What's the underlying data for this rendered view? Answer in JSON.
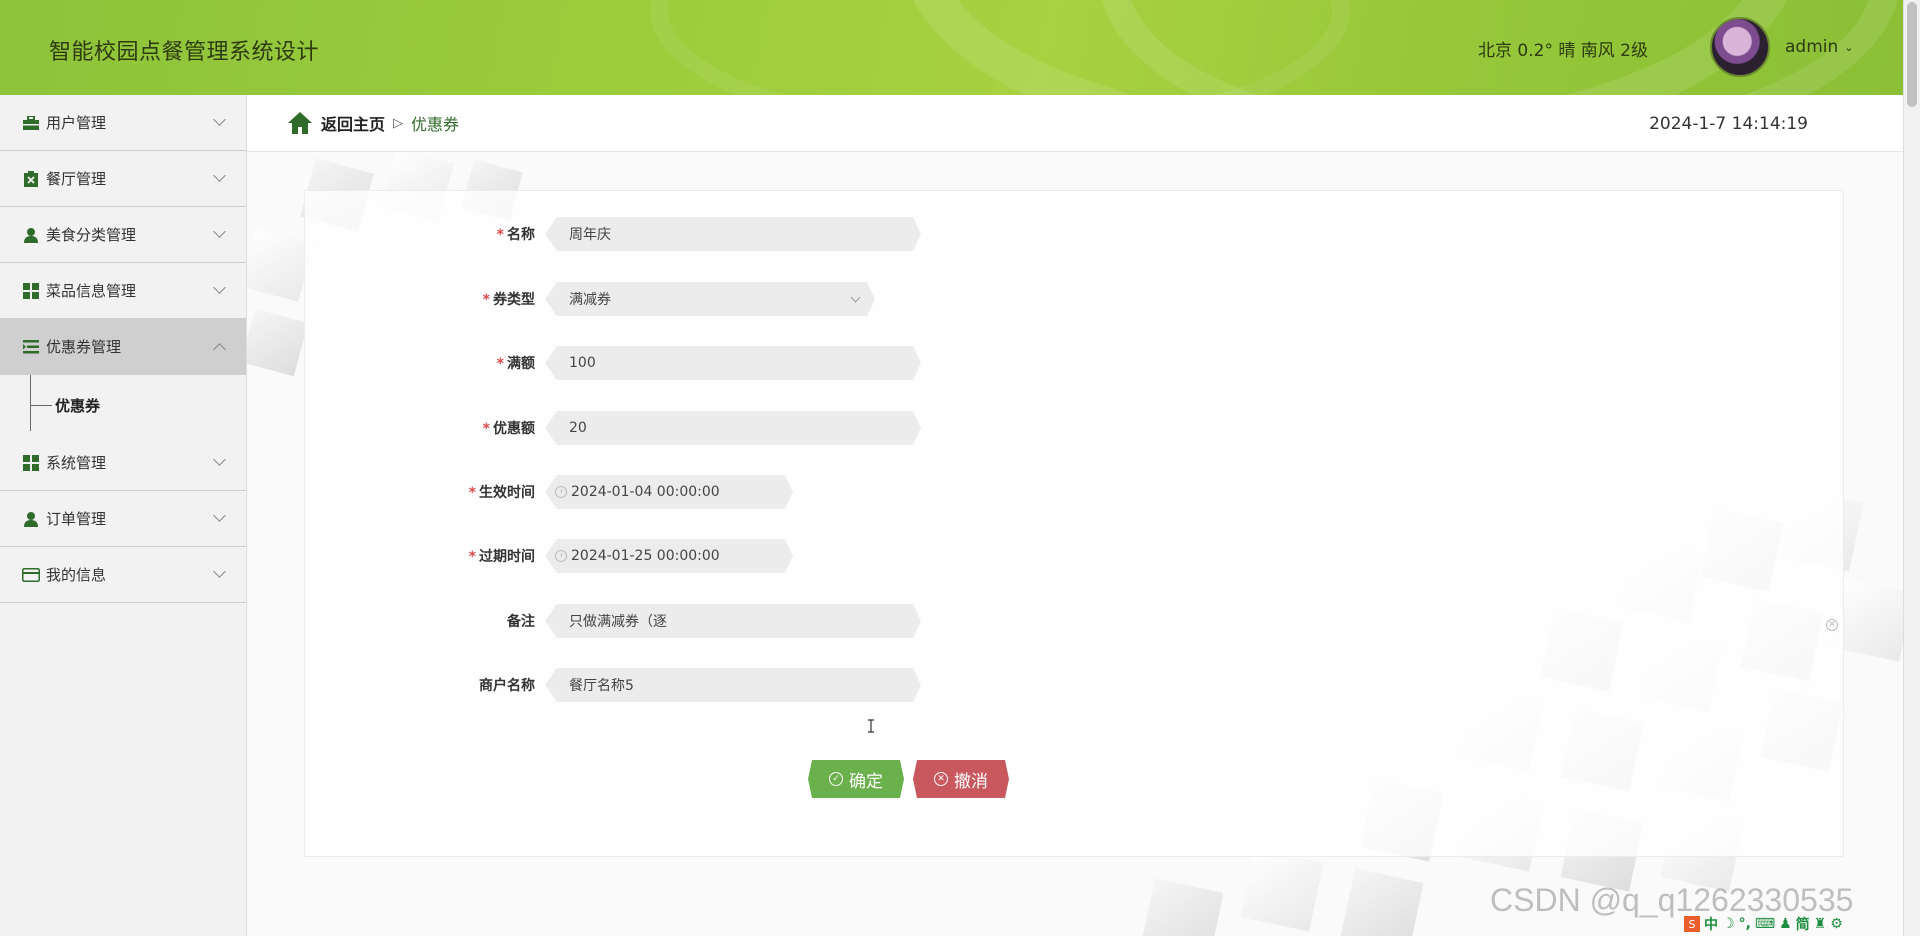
{
  "header": {
    "title": "智能校园点餐管理系统设计",
    "weather": "北京  0.2°  晴  南风  2级",
    "username": "admin"
  },
  "sidebar": {
    "items": [
      {
        "label": "用户管理",
        "icon": "briefcase-icon"
      },
      {
        "label": "餐厅管理",
        "icon": "clipboard-x-icon"
      },
      {
        "label": "美食分类管理",
        "icon": "user-icon"
      },
      {
        "label": "菜品信息管理",
        "icon": "grid-icon"
      },
      {
        "label": "优惠券管理",
        "icon": "list-icon",
        "active": true,
        "children": [
          {
            "label": "优惠券"
          }
        ]
      },
      {
        "label": "系统管理",
        "icon": "grid-icon"
      },
      {
        "label": "订单管理",
        "icon": "user-icon"
      },
      {
        "label": "我的信息",
        "icon": "card-icon"
      }
    ]
  },
  "topbar": {
    "back_home": "返回主页",
    "separator": "▷",
    "current": "优惠券",
    "datetime": "2024-1-7 14:14:19"
  },
  "form": {
    "name": {
      "label": "名称",
      "value": "周年庆",
      "required": true
    },
    "type": {
      "label": "券类型",
      "value": "满减券",
      "required": true
    },
    "threshold": {
      "label": "满额",
      "value": "100",
      "required": true
    },
    "discount": {
      "label": "优惠额",
      "value": "20",
      "required": true
    },
    "start_time": {
      "label": "生效时间",
      "value": "2024-01-04 00:00:00",
      "required": true
    },
    "end_time": {
      "label": "过期时间",
      "value": "2024-01-25 00:00:00",
      "required": true
    },
    "remark": {
      "label": "备注",
      "value": "只做满减券（逐",
      "required": false
    },
    "merchant": {
      "label": "商户名称",
      "value": "餐厅名称5",
      "required": false
    }
  },
  "buttons": {
    "confirm": "确定",
    "cancel": "撤消"
  },
  "watermark": "CSDN @q_q1262330535",
  "ime": {
    "items": [
      "中",
      "简"
    ]
  },
  "colors": {
    "header_green": "#9ccd3c",
    "accent_green": "#2f6b2a",
    "confirm_button": "#6ab04c",
    "cancel_button": "#c9585e",
    "required_star": "#e24a4a"
  }
}
